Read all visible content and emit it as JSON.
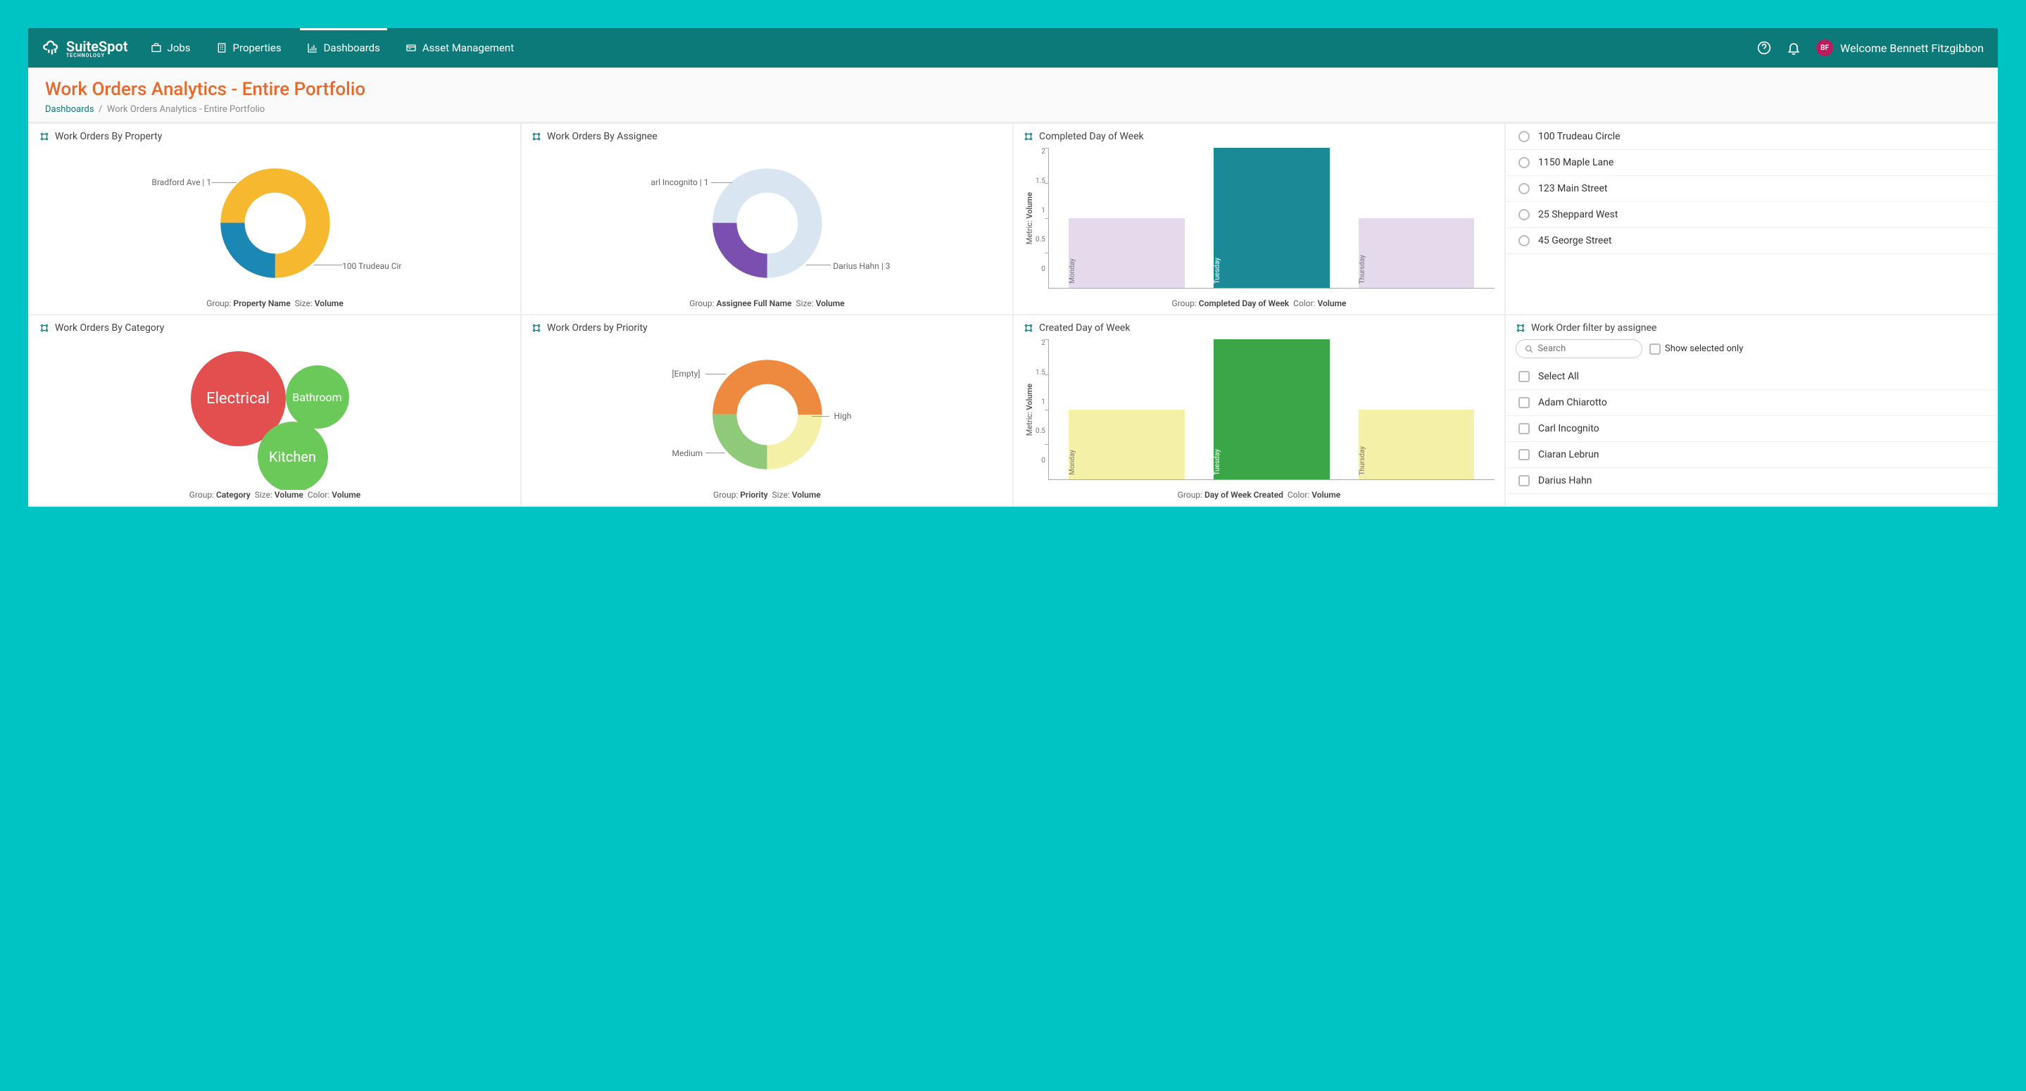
{
  "brand": {
    "name": "SuiteSpot",
    "tagline": "TECHNOLOGY"
  },
  "nav": {
    "items": [
      {
        "label": "Jobs",
        "icon": "briefcase"
      },
      {
        "label": "Properties",
        "icon": "building"
      },
      {
        "label": "Dashboards",
        "icon": "chart",
        "active": true
      },
      {
        "label": "Asset Management",
        "icon": "card"
      }
    ]
  },
  "user": {
    "initials": "BF",
    "welcome": "Welcome Bennett Fitzgibbon"
  },
  "page": {
    "title": "Work Orders Analytics - Entire Portfolio",
    "breadcrumb_root": "Dashboards",
    "breadcrumb_sep": "/",
    "breadcrumb_current": "Work Orders Analytics - Entire Portfolio"
  },
  "cards": {
    "byProperty": {
      "title": "Work Orders By Property",
      "footer": {
        "group_lbl": "Group:",
        "group": "Property Name",
        "size_lbl": "Size:",
        "size": "Volume"
      },
      "callouts": {
        "a": "Bradford Ave | 1",
        "b": "100 Trudeau Cir"
      }
    },
    "byAssignee": {
      "title": "Work Orders By Assignee",
      "footer": {
        "group_lbl": "Group:",
        "group": "Assignee Full Name",
        "size_lbl": "Size:",
        "size": "Volume"
      },
      "callouts": {
        "a": "arl Incognito | 1",
        "b": "Darius Hahn | 3"
      }
    },
    "completedDow": {
      "title": "Completed Day of Week",
      "footer": {
        "group_lbl": "Group:",
        "group": "Completed Day of Week",
        "color_lbl": "Color:",
        "color": "Volume"
      },
      "y_label_a": "Metric:",
      "y_label_b": "Volume",
      "ticks": [
        "2",
        "1.5",
        "1",
        "0.5",
        "0"
      ],
      "bars": [
        "Monday",
        "Tuesday",
        "Thursday"
      ]
    },
    "byCategory": {
      "title": "Work Orders By Category",
      "footer": {
        "group_lbl": "Group:",
        "group": "Category",
        "size_lbl": "Size:",
        "size": "Volume",
        "color_lbl": "Color:",
        "color": "Volume"
      },
      "bubbles": {
        "a": "Electrical",
        "b": "Bathroom",
        "c": "Kitchen"
      }
    },
    "byPriority": {
      "title": "Work Orders by Priority",
      "footer": {
        "group_lbl": "Group:",
        "group": "Priority",
        "size_lbl": "Size:",
        "size": "Volume"
      },
      "callouts": {
        "a": "[Empty]",
        "b": "High",
        "c": "Medium"
      }
    },
    "createdDow": {
      "title": "Created Day of Week",
      "footer": {
        "group_lbl": "Group:",
        "group": "Day of Week Created",
        "color_lbl": "Color:",
        "color": "Volume"
      },
      "y_label_a": "Metric:",
      "y_label_b": "Volume",
      "ticks": [
        "2",
        "1.5",
        "1",
        "0.5",
        "0"
      ],
      "bars": [
        "Monday",
        "Tuesday",
        "Thursday"
      ]
    },
    "propertyFilter": {
      "items": [
        "100 Trudeau Circle",
        "1150 Maple Lane",
        "123 Main Street",
        "25 Sheppard West",
        "45 George Street"
      ]
    },
    "assigneeFilter": {
      "title": "Work Order filter by assignee",
      "search_placeholder": "Search",
      "show_selected": "Show selected only",
      "select_all": "Select All",
      "items": [
        "Adam Chiarotto",
        "Carl Incognito",
        "Ciaran Lebrun",
        "Darius Hahn"
      ]
    }
  },
  "chart_data": [
    {
      "type": "pie",
      "title": "Work Orders By Property",
      "series": [
        {
          "name": "Bradford Ave",
          "value": 1
        },
        {
          "name": "100 Trudeau Cir",
          "value": 3
        }
      ]
    },
    {
      "type": "pie",
      "title": "Work Orders By Assignee",
      "series": [
        {
          "name": "Carl Incognito",
          "value": 1
        },
        {
          "name": "Darius Hahn",
          "value": 3
        }
      ]
    },
    {
      "type": "bar",
      "title": "Completed Day of Week",
      "categories": [
        "Monday",
        "Tuesday",
        "Thursday"
      ],
      "values": [
        1,
        2,
        1
      ],
      "ylabel": "Metric: Volume",
      "ylim": [
        0,
        2
      ]
    },
    {
      "type": "bubble",
      "title": "Work Orders By Category",
      "series": [
        {
          "name": "Electrical",
          "value": 2
        },
        {
          "name": "Bathroom",
          "value": 1
        },
        {
          "name": "Kitchen",
          "value": 1
        }
      ]
    },
    {
      "type": "pie",
      "title": "Work Orders by Priority",
      "series": [
        {
          "name": "[Empty]",
          "value": 1
        },
        {
          "name": "High",
          "value": 2
        },
        {
          "name": "Medium",
          "value": 1
        }
      ]
    },
    {
      "type": "bar",
      "title": "Created Day of Week",
      "categories": [
        "Monday",
        "Tuesday",
        "Thursday"
      ],
      "values": [
        1,
        2,
        1
      ],
      "ylabel": "Metric: Volume",
      "ylim": [
        0,
        2
      ]
    }
  ]
}
